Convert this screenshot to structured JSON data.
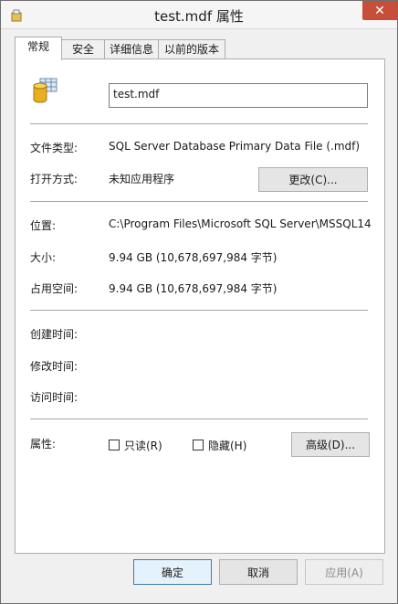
{
  "window": {
    "title": "test.mdf 属性",
    "close_glyph": "✕"
  },
  "tabs": [
    {
      "label": "常规",
      "active": true
    },
    {
      "label": "安全",
      "active": false
    },
    {
      "label": "详细信息",
      "active": false
    },
    {
      "label": "以前的版本",
      "active": false
    }
  ],
  "general": {
    "file_name": "test.mdf",
    "file_type_label": "文件类型:",
    "file_type_value": "SQL Server Database Primary Data File (.mdf)",
    "opens_with_label": "打开方式:",
    "opens_with_value": "未知应用程序",
    "change_button": "更改(C)...",
    "location_label": "位置:",
    "location_value": "C:\\Program Files\\Microsoft SQL Server\\MSSQL14",
    "size_label": "大小:",
    "size_value": "9.94 GB (10,678,697,984 字节)",
    "size_on_disk_label": "占用空间:",
    "size_on_disk_value": "9.94 GB (10,678,697,984 字节)",
    "created_label": "创建时间:",
    "modified_label": "修改时间:",
    "accessed_label": "访问时间:",
    "attributes_label": "属性:",
    "readonly_label": "只读(R)",
    "hidden_label": "隐藏(H)",
    "advanced_button": "高级(D)..."
  },
  "footer": {
    "ok": "确定",
    "cancel": "取消",
    "apply": "应用(A)"
  },
  "colors": {
    "close_button": "#c74f3a",
    "default_button_border": "#3c7fb1",
    "db_icon": "#e8b020"
  }
}
